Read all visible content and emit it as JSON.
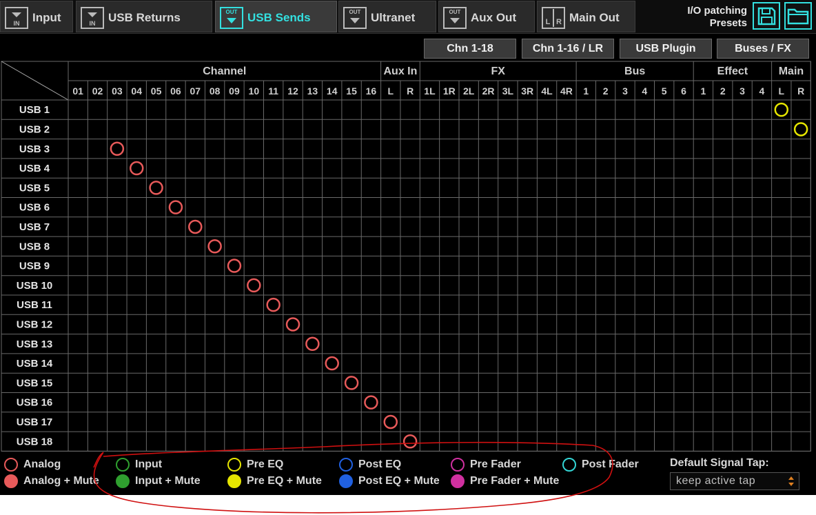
{
  "tabs": [
    {
      "label": "Input",
      "icon": "input-icon",
      "icon_text": "IN",
      "active": false
    },
    {
      "label": "USB Returns",
      "icon": "input-icon",
      "icon_text": "IN",
      "active": false
    },
    {
      "label": "USB Sends",
      "icon": "output-icon",
      "icon_text": "OUT",
      "active": true
    },
    {
      "label": "Ultranet",
      "icon": "output-icon",
      "icon_text": "OUT",
      "active": false
    },
    {
      "label": "Aux Out",
      "icon": "output-icon",
      "icon_text": "OUT",
      "active": false
    },
    {
      "label": "Main Out",
      "icon": "main-out-icon",
      "icon_text": "LR",
      "active": false
    }
  ],
  "presets": {
    "line1": "I/O patching",
    "line2": "Presets",
    "save_icon": "save-icon",
    "open_icon": "folder-icon"
  },
  "bank_buttons": [
    "Chn 1-18",
    "Chn 1-16 / LR",
    "USB Plugin",
    "Buses / FX"
  ],
  "groups": [
    {
      "label": "Channel",
      "columns": [
        "01",
        "02",
        "03",
        "04",
        "05",
        "06",
        "07",
        "08",
        "09",
        "10",
        "11",
        "12",
        "13",
        "14",
        "15",
        "16"
      ]
    },
    {
      "label": "Aux In",
      "columns": [
        "L",
        "R"
      ]
    },
    {
      "label": "FX",
      "columns": [
        "1L",
        "1R",
        "2L",
        "2R",
        "3L",
        "3R",
        "4L",
        "4R"
      ]
    },
    {
      "label": "Bus",
      "columns": [
        "1",
        "2",
        "3",
        "4",
        "5",
        "6"
      ]
    },
    {
      "label": "Effect",
      "columns": [
        "1",
        "2",
        "3",
        "4"
      ]
    },
    {
      "label": "Main",
      "columns": [
        "L",
        "R"
      ]
    }
  ],
  "rows": [
    "USB 1",
    "USB 2",
    "USB 3",
    "USB 4",
    "USB 5",
    "USB 6",
    "USB 7",
    "USB 8",
    "USB 9",
    "USB 10",
    "USB 11",
    "USB 12",
    "USB 13",
    "USB 14",
    "USB 15",
    "USB 16",
    "USB 17",
    "USB 18"
  ],
  "patches": [
    {
      "row": 0,
      "col": 36,
      "tap": "Pre EQ"
    },
    {
      "row": 1,
      "col": 37,
      "tap": "Pre EQ"
    },
    {
      "row": 2,
      "col": 2,
      "tap": "Analog"
    },
    {
      "row": 3,
      "col": 3,
      "tap": "Analog"
    },
    {
      "row": 4,
      "col": 4,
      "tap": "Analog"
    },
    {
      "row": 5,
      "col": 5,
      "tap": "Analog"
    },
    {
      "row": 6,
      "col": 6,
      "tap": "Analog"
    },
    {
      "row": 7,
      "col": 7,
      "tap": "Analog"
    },
    {
      "row": 8,
      "col": 8,
      "tap": "Analog"
    },
    {
      "row": 9,
      "col": 9,
      "tap": "Analog"
    },
    {
      "row": 10,
      "col": 10,
      "tap": "Analog"
    },
    {
      "row": 11,
      "col": 11,
      "tap": "Analog"
    },
    {
      "row": 12,
      "col": 12,
      "tap": "Analog"
    },
    {
      "row": 13,
      "col": 13,
      "tap": "Analog"
    },
    {
      "row": 14,
      "col": 14,
      "tap": "Analog"
    },
    {
      "row": 15,
      "col": 15,
      "tap": "Analog"
    },
    {
      "row": 16,
      "col": 16,
      "tap": "Analog"
    },
    {
      "row": 17,
      "col": 17,
      "tap": "Analog"
    }
  ],
  "legend": [
    {
      "label": "Analog",
      "color": "#e85a5a",
      "filled": false
    },
    {
      "label": "Input",
      "color": "#2fa02f",
      "filled": false
    },
    {
      "label": "Pre EQ",
      "color": "#e6e600",
      "filled": false
    },
    {
      "label": "Post EQ",
      "color": "#2060e0",
      "filled": false
    },
    {
      "label": "Pre Fader",
      "color": "#d030a0",
      "filled": false
    },
    {
      "label": "Post Fader",
      "color": "#33d6d6",
      "filled": false
    },
    {
      "label": "Analog + Mute",
      "color": "#e85a5a",
      "filled": true
    },
    {
      "label": "Input + Mute",
      "color": "#2fa02f",
      "filled": true
    },
    {
      "label": "Pre EQ + Mute",
      "color": "#e6e600",
      "filled": true
    },
    {
      "label": "Post EQ + Mute",
      "color": "#2060e0",
      "filled": true
    },
    {
      "label": "Pre Fader + Mute",
      "color": "#d030a0",
      "filled": true
    }
  ],
  "default_tap": {
    "label": "Default Signal Tap:",
    "value": "keep active tap"
  },
  "colors": {
    "accent": "#33e0e0",
    "grid": "#6a6a6a",
    "annotation": "#d01010"
  }
}
